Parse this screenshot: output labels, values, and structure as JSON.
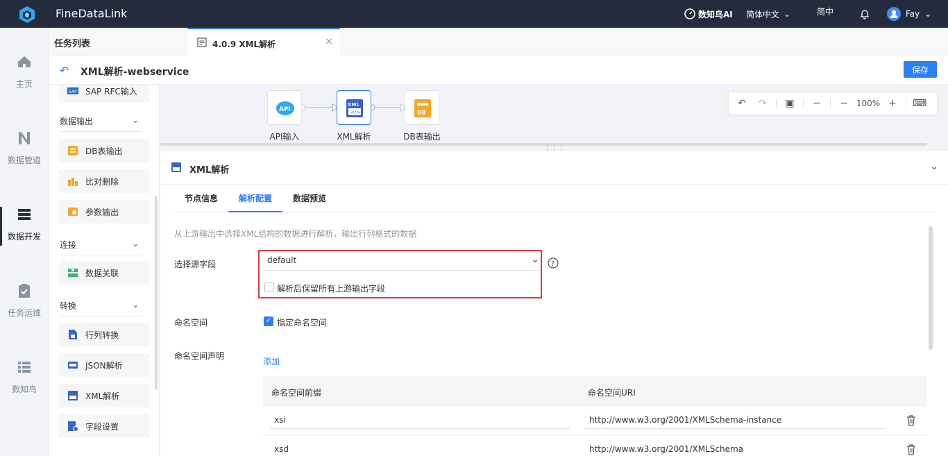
{
  "app": {
    "name": "FineDataLink"
  },
  "topbar": {
    "ai_label": "数知鸟AI",
    "language": "简体中文",
    "simplified": "简中",
    "user": "Fay"
  },
  "rail": [
    {
      "label": "主页"
    },
    {
      "label": "数据管道"
    },
    {
      "label": "数据开发"
    },
    {
      "label": "任务运维"
    },
    {
      "label": "数知鸟"
    }
  ],
  "header": {
    "task_list": "任务列表",
    "tab_label": "4.0.9 XML解析",
    "page_title": "XML解析-webservice",
    "save": "保存"
  },
  "components": {
    "top_item": "SAP RFC输入",
    "groups": [
      {
        "title": "数据输出",
        "items": [
          "DB表输出",
          "比对删除",
          "参数输出"
        ]
      },
      {
        "title": "连接",
        "items": [
          "数据关联"
        ]
      },
      {
        "title": "转换",
        "items": [
          "行列转换",
          "JSON解析",
          "XML解析",
          "字段设置"
        ]
      }
    ]
  },
  "canvas": {
    "nodes": [
      {
        "label": "API输入",
        "badge": "API"
      },
      {
        "label": "XML解析",
        "badge": "XML"
      },
      {
        "label": "DB表输出",
        "badge": "DB"
      }
    ],
    "zoom": "100%"
  },
  "detail": {
    "title": "XML解析",
    "tabs": [
      "节点信息",
      "解析配置",
      "数据预览"
    ],
    "active_tab": "解析配置",
    "hint": "从上游输出中选择XML结构的数据进行解析，输出行列格式的数据",
    "source_field_label": "选择源字段",
    "source_field_value": "default",
    "keep_upstream_label": "解析后保留所有上游输出字段",
    "keep_upstream_checked": false,
    "namespace_label": "命名空间",
    "namespace_check_label": "指定命名空间",
    "namespace_checked": true,
    "ns_decl_label": "命名空间声明",
    "add_link": "添加",
    "table": {
      "headers": [
        "命名空间前缀",
        "命名空间URI"
      ],
      "rows": [
        {
          "prefix": "xsi",
          "uri": "http://www.w3.org/2001/XMLSchema-instance"
        },
        {
          "prefix": "xsd",
          "uri": "http://www.w3.org/2001/XMLSchema"
        }
      ]
    }
  },
  "colors": {
    "accent": "#2d7ff5",
    "topbar": "#232b3c",
    "highlight": "#e03a3a",
    "node_orange": "#f5a623"
  }
}
